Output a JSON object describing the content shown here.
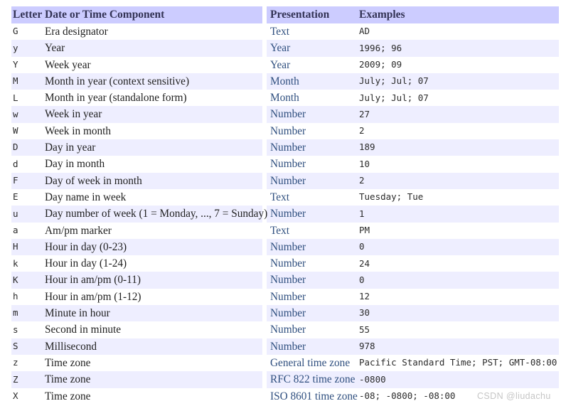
{
  "table": {
    "headers": {
      "letter": "Letter",
      "component": "Date or Time Component",
      "presentation": "Presentation",
      "examples": "Examples"
    },
    "rows": [
      {
        "letter": "G",
        "component": "Era designator",
        "presentation": "Text",
        "examples": "AD"
      },
      {
        "letter": "y",
        "component": "Year",
        "presentation": "Year",
        "examples": "1996; 96"
      },
      {
        "letter": "Y",
        "component": "Week year",
        "presentation": "Year",
        "examples": "2009; 09"
      },
      {
        "letter": "M",
        "component": "Month in year (context sensitive)",
        "presentation": "Month",
        "examples": "July; Jul; 07"
      },
      {
        "letter": "L",
        "component": "Month in year (standalone form)",
        "presentation": "Month",
        "examples": "July; Jul; 07"
      },
      {
        "letter": "w",
        "component": "Week in year",
        "presentation": "Number",
        "examples": "27"
      },
      {
        "letter": "W",
        "component": "Week in month",
        "presentation": "Number",
        "examples": "2"
      },
      {
        "letter": "D",
        "component": "Day in year",
        "presentation": "Number",
        "examples": "189"
      },
      {
        "letter": "d",
        "component": "Day in month",
        "presentation": "Number",
        "examples": "10"
      },
      {
        "letter": "F",
        "component": "Day of week in month",
        "presentation": "Number",
        "examples": "2"
      },
      {
        "letter": "E",
        "component": "Day name in week",
        "presentation": "Text",
        "examples": "Tuesday; Tue"
      },
      {
        "letter": "u",
        "component": "Day number of week (1 = Monday, ..., 7 = Sunday)",
        "presentation": "Number",
        "examples": "1"
      },
      {
        "letter": "a",
        "component": "Am/pm marker",
        "presentation": "Text",
        "examples": "PM"
      },
      {
        "letter": "H",
        "component": "Hour in day (0-23)",
        "presentation": "Number",
        "examples": "0"
      },
      {
        "letter": "k",
        "component": "Hour in day (1-24)",
        "presentation": "Number",
        "examples": "24"
      },
      {
        "letter": "K",
        "component": "Hour in am/pm (0-11)",
        "presentation": "Number",
        "examples": "0"
      },
      {
        "letter": "h",
        "component": "Hour in am/pm (1-12)",
        "presentation": "Number",
        "examples": "12"
      },
      {
        "letter": "m",
        "component": "Minute in hour",
        "presentation": "Number",
        "examples": "30"
      },
      {
        "letter": "s",
        "component": "Second in minute",
        "presentation": "Number",
        "examples": "55"
      },
      {
        "letter": "S",
        "component": "Millisecond",
        "presentation": "Number",
        "examples": "978"
      },
      {
        "letter": "z",
        "component": "Time zone",
        "presentation": "General time zone",
        "examples": "Pacific Standard Time; PST; GMT-08:00"
      },
      {
        "letter": "Z",
        "component": "Time zone",
        "presentation": "RFC 822 time zone",
        "examples": "-0800"
      },
      {
        "letter": "X",
        "component": "Time zone",
        "presentation": "ISO 8601 time zone",
        "examples": "-08; -0800; -08:00"
      }
    ]
  },
  "watermark": {
    "text": "CSDN @liudachu"
  },
  "colors": {
    "header_background": "#ccccff",
    "row_alt_background": "#eeeeff",
    "row_background": "#ffffff",
    "presentation_text": "#2f4f7f",
    "body_text": "#1f1f1f",
    "watermark_text": "#c6c6c6"
  }
}
